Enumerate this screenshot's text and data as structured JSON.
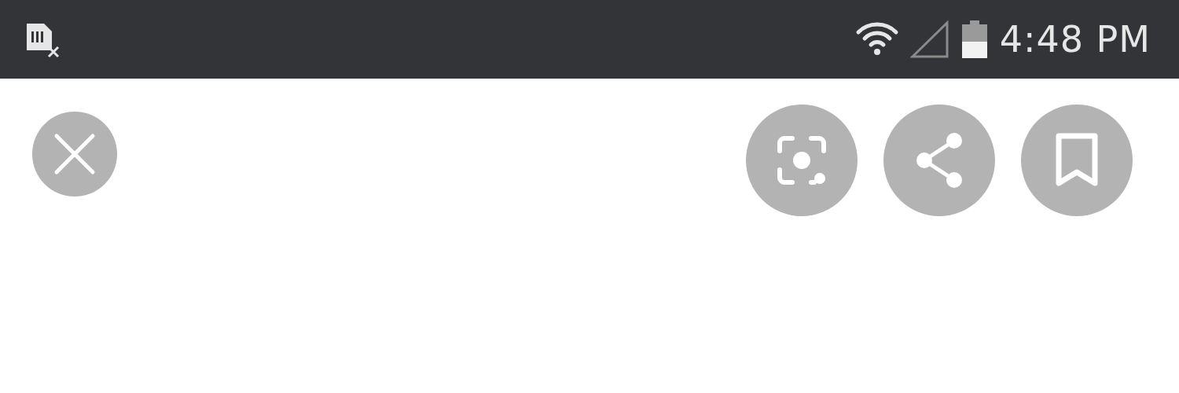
{
  "status_bar": {
    "time": "4:48 PM"
  }
}
